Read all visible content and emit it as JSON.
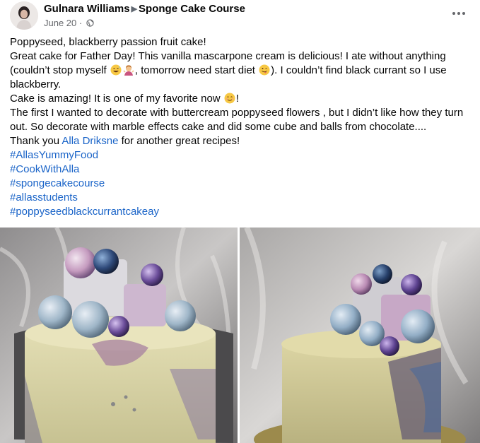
{
  "post": {
    "author": "Gulnara Williams",
    "group": "Sponge Cake Course",
    "date": "June 20",
    "date_separator": "·",
    "audience_icon": "globe-icon",
    "more_icon": "more-options-icon",
    "lines": {
      "l1": "Poppyseed, blackberry passion fruit cake!",
      "l2a": "Great cake for Father Day! This vanilla mascarpone cream is delicious! I ate without anything (couldn’t stop myself ",
      "l2b": ", tomorrow need start diet ",
      "l2c": "). I couldn’t find black currant so I use blackberry.",
      "l3a": "Cake is amazing! It is one of my favorite now ",
      "l3b": "!",
      "l4": "The first I wanted to decorate with buttercream poppyseed flowers , but I didn’t like how they turn out. So decorate with marble effects cake and did some cube and balls from chocolate....",
      "l5a": "Thank you ",
      "mention": "Alla Driksne",
      "l5b": " for another great recipes!"
    },
    "hashtags": [
      "#AllasYummyFood",
      "#CookWithAlla",
      "#spongecakecourse",
      "#allasstudents",
      "#poppyseedblackcurrantcakeay"
    ],
    "emojis": [
      "grinning-sweat-emoji",
      "woman-shrugging-emoji",
      "winking-tongue-emoji",
      "smiling-blush-emoji"
    ],
    "photos": [
      "cake-photo-1",
      "cake-photo-2"
    ],
    "colors": {
      "link": "#1a64c8",
      "text": "#050505",
      "meta": "#65676b"
    }
  }
}
